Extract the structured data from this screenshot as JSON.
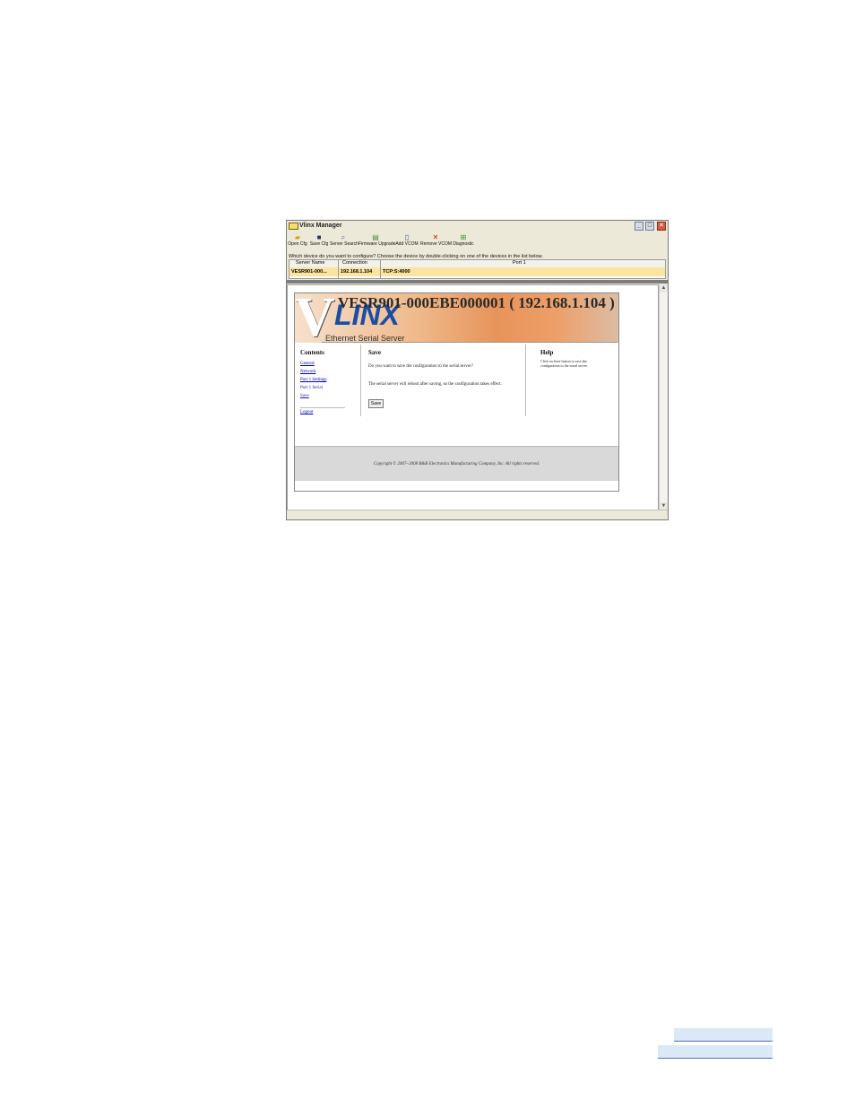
{
  "window": {
    "title": "Vlinx Manager",
    "minimize": "_",
    "maximize": "□",
    "close": "×"
  },
  "toolbar": {
    "items": [
      {
        "label": "Open Cfg",
        "icon": "folder-icon"
      },
      {
        "label": "Save Cfg",
        "icon": "floppy-icon"
      },
      {
        "label": "Server Search",
        "icon": "magnifier-icon"
      },
      {
        "label": "Firmware Upgrade",
        "icon": "chip-icon"
      },
      {
        "label": "Add VCOM",
        "icon": "document-icon"
      },
      {
        "label": "Remove VCOM",
        "icon": "red-x-icon"
      },
      {
        "label": "Diagnostic",
        "icon": "diagnostic-icon"
      }
    ]
  },
  "device_prompt": "Which device do you want to configure? Choose the device by double-clicking on one of the devices in the list below.",
  "device_table": {
    "columns": [
      "Server Name",
      "Connection",
      "Port 1"
    ],
    "rows": [
      {
        "server_name": "VESR901-000...",
        "connection": "192.168.1.104",
        "port1": "TCP:S:4000"
      }
    ]
  },
  "web": {
    "device_title": "VESR901-000EBE000001 ( 192.168.1.104 )",
    "logo_v": "V",
    "logo_text": "LINX",
    "subtitle": "Ethernet Serial Server",
    "contents_heading": "Contents",
    "nav": [
      "General",
      "Network",
      "Port 1 Settings",
      "Port 1 Serial",
      "Save",
      "Logout"
    ],
    "save_heading": "Save",
    "save_question": "Do you want to save the configuration to the serial server?",
    "save_note": "The serial server will reboot after saving, so the configuration takes effect.",
    "save_button": "Save",
    "help_heading": "Help",
    "help_line1": "Click on Save button to save the",
    "help_line2": "configuration to the serial server.",
    "copyright": "Copyright © 2007~2008 B&B Electronics Manufacturing Company, Inc. All rights reserved."
  },
  "scrollbar": {
    "up": "▲",
    "down": "▼"
  }
}
